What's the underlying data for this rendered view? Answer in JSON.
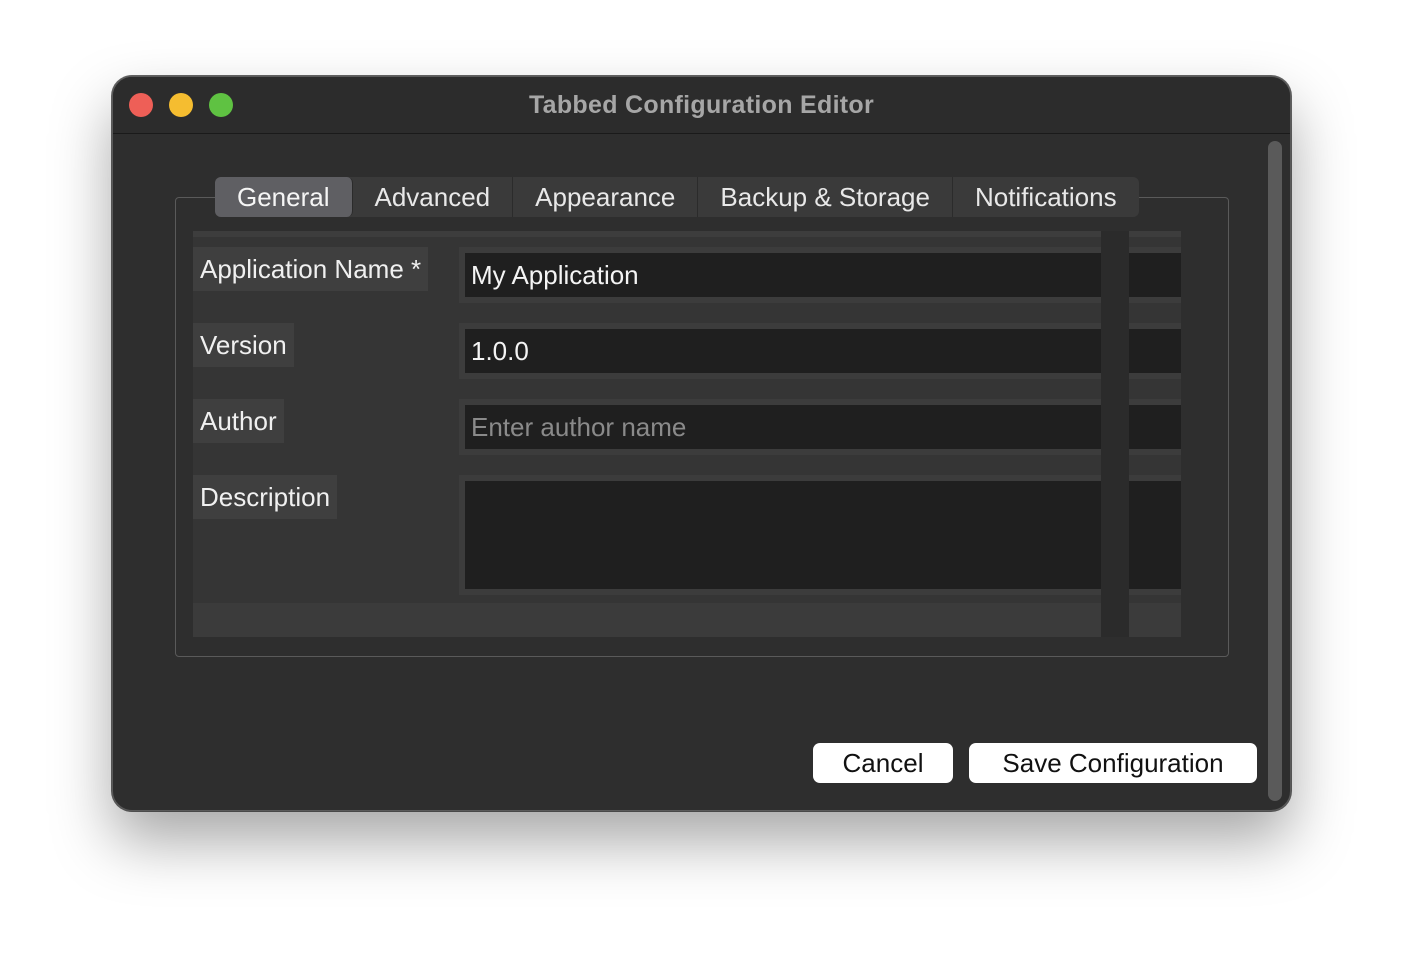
{
  "window": {
    "title": "Tabbed Configuration Editor"
  },
  "tabs": [
    {
      "label": "General",
      "active": true
    },
    {
      "label": "Advanced",
      "active": false
    },
    {
      "label": "Appearance",
      "active": false
    },
    {
      "label": "Backup & Storage",
      "active": false
    },
    {
      "label": "Notifications",
      "active": false
    }
  ],
  "form": {
    "app_name": {
      "label": "Application Name *",
      "value": "My Application"
    },
    "version": {
      "label": "Version",
      "value": "1.0.0"
    },
    "author": {
      "label": "Author",
      "value": "",
      "placeholder": "Enter author name"
    },
    "description": {
      "label": "Description",
      "value": ""
    }
  },
  "buttons": {
    "cancel": "Cancel",
    "save": "Save Configuration"
  },
  "colors": {
    "close": "#ee5f57",
    "minimize": "#f5bd30",
    "maximize": "#5fc242",
    "window_bg": "#2e2e2e",
    "field_bg": "#1f1f1f"
  }
}
